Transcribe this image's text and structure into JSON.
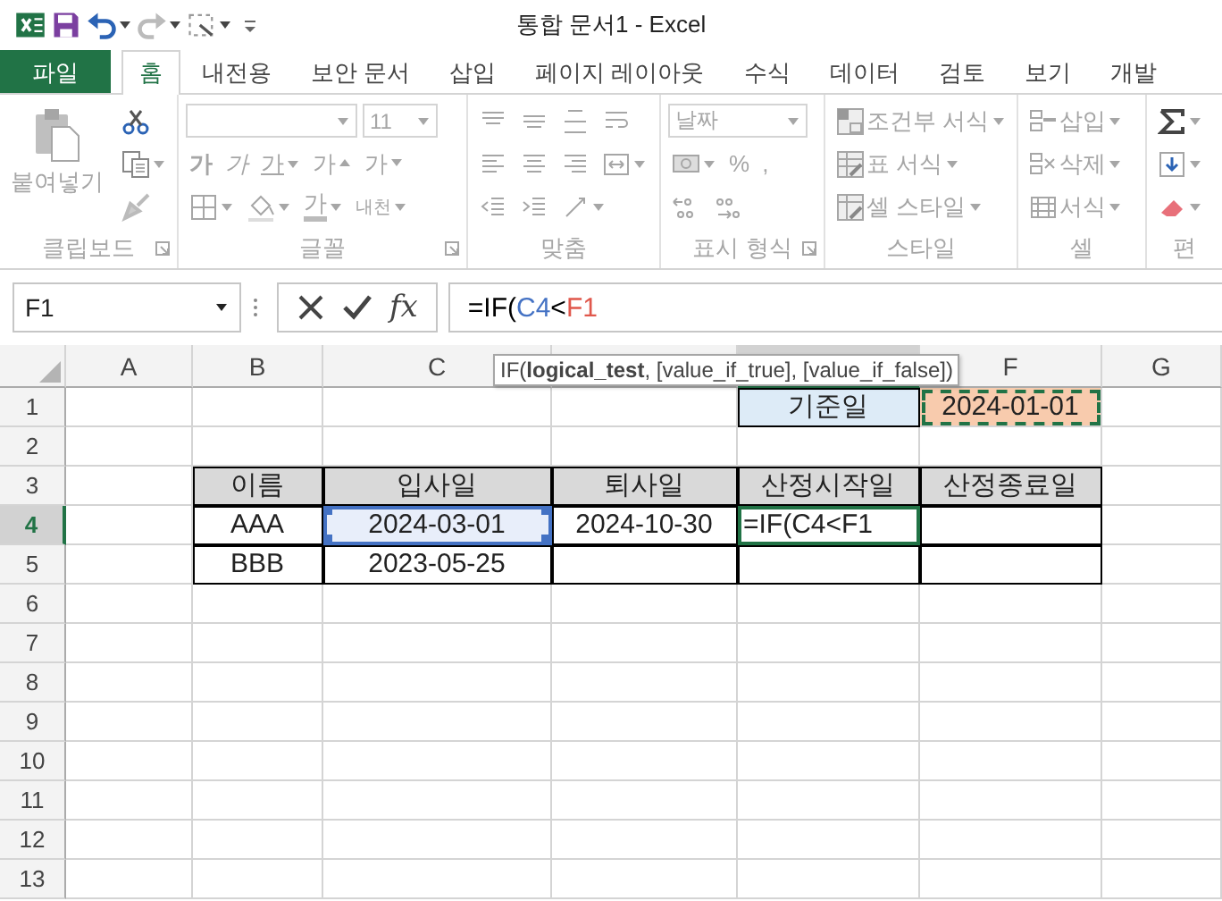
{
  "title_bar": {
    "title": "통합 문서1 - Excel"
  },
  "tabs": [
    {
      "label": "파일",
      "kind": "file",
      "selected": false
    },
    {
      "label": "홈",
      "kind": "tab",
      "selected": true
    },
    {
      "label": "내전용",
      "kind": "tab",
      "selected": false
    },
    {
      "label": "보안 문서",
      "kind": "tab",
      "selected": false
    },
    {
      "label": "삽입",
      "kind": "tab",
      "selected": false
    },
    {
      "label": "페이지 레이아웃",
      "kind": "tab",
      "selected": false
    },
    {
      "label": "수식",
      "kind": "tab",
      "selected": false
    },
    {
      "label": "데이터",
      "kind": "tab",
      "selected": false
    },
    {
      "label": "검토",
      "kind": "tab",
      "selected": false
    },
    {
      "label": "보기",
      "kind": "tab",
      "selected": false
    },
    {
      "label": "개발",
      "kind": "tab",
      "selected": false
    }
  ],
  "ribbon": {
    "disabled": true,
    "groups": [
      {
        "label": "클립보드",
        "launcher": true,
        "big": {
          "kind": "paste",
          "text": "붙여넣기"
        },
        "lines": [
          {
            "controls": [
              {
                "kind": "scissors"
              }
            ]
          },
          {
            "controls": [
              {
                "kind": "copy",
                "menu": true
              }
            ]
          },
          {
            "controls": [
              {
                "kind": "brush"
              }
            ]
          }
        ]
      },
      {
        "label": "글꼴",
        "launcher": true,
        "lines": [
          {
            "controls": [
              {
                "kind": "font-box"
              },
              {
                "kind": "size-box",
                "text": "11"
              }
            ]
          },
          {
            "controls": [
              {
                "kind": "bold",
                "text": "가"
              },
              {
                "kind": "italic",
                "text": "가"
              },
              {
                "kind": "underline",
                "text": "가",
                "menu": true
              },
              {
                "kind": "grow",
                "text": "가"
              },
              {
                "kind": "shrink",
                "text": "가"
              }
            ]
          },
          {
            "controls": [
              {
                "kind": "border",
                "menu": true
              },
              {
                "kind": "bucket",
                "menu": true
              },
              {
                "kind": "font-color",
                "text": "가",
                "menu": true
              },
              {
                "kind": "phonetic",
                "text": "내천",
                "menu": true
              }
            ]
          }
        ]
      },
      {
        "label": "맞춤",
        "launcher": false,
        "lines": [
          {
            "controls": [
              {
                "kind": "align-top"
              },
              {
                "kind": "align-middle"
              },
              {
                "kind": "align-bottom"
              },
              {
                "kind": "wrap"
              }
            ]
          },
          {
            "controls": [
              {
                "kind": "align-left"
              },
              {
                "kind": "align-center"
              },
              {
                "kind": "align-right"
              },
              {
                "kind": "merge",
                "menu": true
              }
            ]
          },
          {
            "controls": [
              {
                "kind": "outdent"
              },
              {
                "kind": "indent"
              },
              {
                "kind": "orientation",
                "menu": true
              }
            ]
          }
        ]
      },
      {
        "label": "표시 형식",
        "launcher": true,
        "lines": [
          {
            "controls": [
              {
                "kind": "format-box",
                "text": "날짜"
              }
            ]
          },
          {
            "controls": [
              {
                "kind": "currency",
                "menu": true
              },
              {
                "kind": "symbol",
                "text": "%"
              },
              {
                "kind": "symbol",
                "text": ","
              }
            ]
          },
          {
            "controls": [
              {
                "kind": "inc-decimal"
              },
              {
                "kind": "dec-decimal"
              }
            ]
          }
        ]
      },
      {
        "label": "스타일",
        "launcher": false,
        "lines": [
          {
            "controls": [
              {
                "kind": "cond-format",
                "text": "조건부 서식",
                "menu": true
              }
            ]
          },
          {
            "controls": [
              {
                "kind": "table-format",
                "text": "표 서식",
                "menu": true
              }
            ]
          },
          {
            "controls": [
              {
                "kind": "cell-style",
                "text": "셀 스타일",
                "menu": true
              }
            ]
          }
        ]
      },
      {
        "label": "셀",
        "launcher": false,
        "lines": [
          {
            "controls": [
              {
                "kind": "insert",
                "text": "삽입",
                "menu": true
              }
            ]
          },
          {
            "controls": [
              {
                "kind": "delete",
                "text": "삭제",
                "menu": true
              }
            ]
          },
          {
            "controls": [
              {
                "kind": "format",
                "text": "서식",
                "menu": true
              }
            ]
          }
        ]
      },
      {
        "label": "편",
        "launcher": false,
        "lines": [
          {
            "controls": [
              {
                "kind": "sum",
                "menu": true
              }
            ]
          },
          {
            "controls": [
              {
                "kind": "fill",
                "menu": true
              }
            ]
          },
          {
            "controls": [
              {
                "kind": "eraser",
                "menu": true
              }
            ]
          }
        ]
      }
    ]
  },
  "formula_bar": {
    "name_box": "F1",
    "fx": "fx",
    "formula": [
      {
        "text": "=IF(",
        "color": "#000000"
      },
      {
        "text": "C4",
        "color": "#4472c4"
      },
      {
        "text": "<",
        "color": "#000000"
      },
      {
        "text": "F1",
        "color": "#e0584c"
      }
    ]
  },
  "tooltip": "IF(**logical_test**, [value_if_true], [value_if_false])",
  "columns": [
    {
      "label": "A",
      "selected": false
    },
    {
      "label": "B",
      "selected": false
    },
    {
      "label": "C",
      "selected": false
    },
    {
      "selected": false
    },
    {
      "selected": true
    },
    {
      "label": "F",
      "selected": false
    },
    {
      "label": "G",
      "selected": false
    }
  ],
  "rows": [
    {
      "label": "1",
      "selected": false,
      "cells": [
        {
          "kind": "empty"
        },
        {
          "kind": "empty"
        },
        {
          "kind": "empty"
        },
        {
          "kind": "empty"
        },
        {
          "kind": "label",
          "text": "기준일"
        },
        {
          "kind": "copy-source",
          "text": "2024-01-01"
        },
        {
          "kind": "empty"
        }
      ]
    },
    {
      "label": "2",
      "selected": false
    },
    {
      "label": "3",
      "selected": false,
      "cells": [
        {
          "kind": "empty"
        },
        {
          "kind": "header",
          "text": "이름"
        },
        {
          "kind": "header",
          "text": "입사일"
        },
        {
          "kind": "header",
          "text": "퇴사일"
        },
        {
          "kind": "header",
          "text": "산정시작일"
        },
        {
          "kind": "header",
          "text": "산정종료일"
        },
        {
          "kind": "empty"
        }
      ]
    },
    {
      "label": "4",
      "selected": true,
      "cells": [
        {
          "kind": "empty"
        },
        {
          "kind": "data",
          "text": "AAA"
        },
        {
          "kind": "reference",
          "text": "2024-03-01"
        },
        {
          "kind": "data",
          "text": "2024-10-30"
        },
        {
          "kind": "editing",
          "text": "=IF(C4<F1"
        },
        {
          "kind": "data"
        },
        {
          "kind": "empty"
        }
      ]
    },
    {
      "label": "5",
      "selected": false,
      "cells": [
        {
          "kind": "empty"
        },
        {
          "kind": "data",
          "text": "BBB"
        },
        {
          "kind": "data",
          "text": "2023-05-25"
        },
        {
          "kind": "data"
        },
        {
          "kind": "data"
        },
        {
          "kind": "data"
        },
        {
          "kind": "empty"
        }
      ]
    },
    {
      "label": "6",
      "selected": false
    },
    {
      "label": "7",
      "selected": false
    },
    {
      "label": "8",
      "selected": false
    },
    {
      "label": "9",
      "selected": false
    },
    {
      "label": "10",
      "selected": false
    },
    {
      "label": "11",
      "selected": false
    },
    {
      "label": "12",
      "selected": false
    },
    {
      "label": "13",
      "selected": false
    }
  ]
}
